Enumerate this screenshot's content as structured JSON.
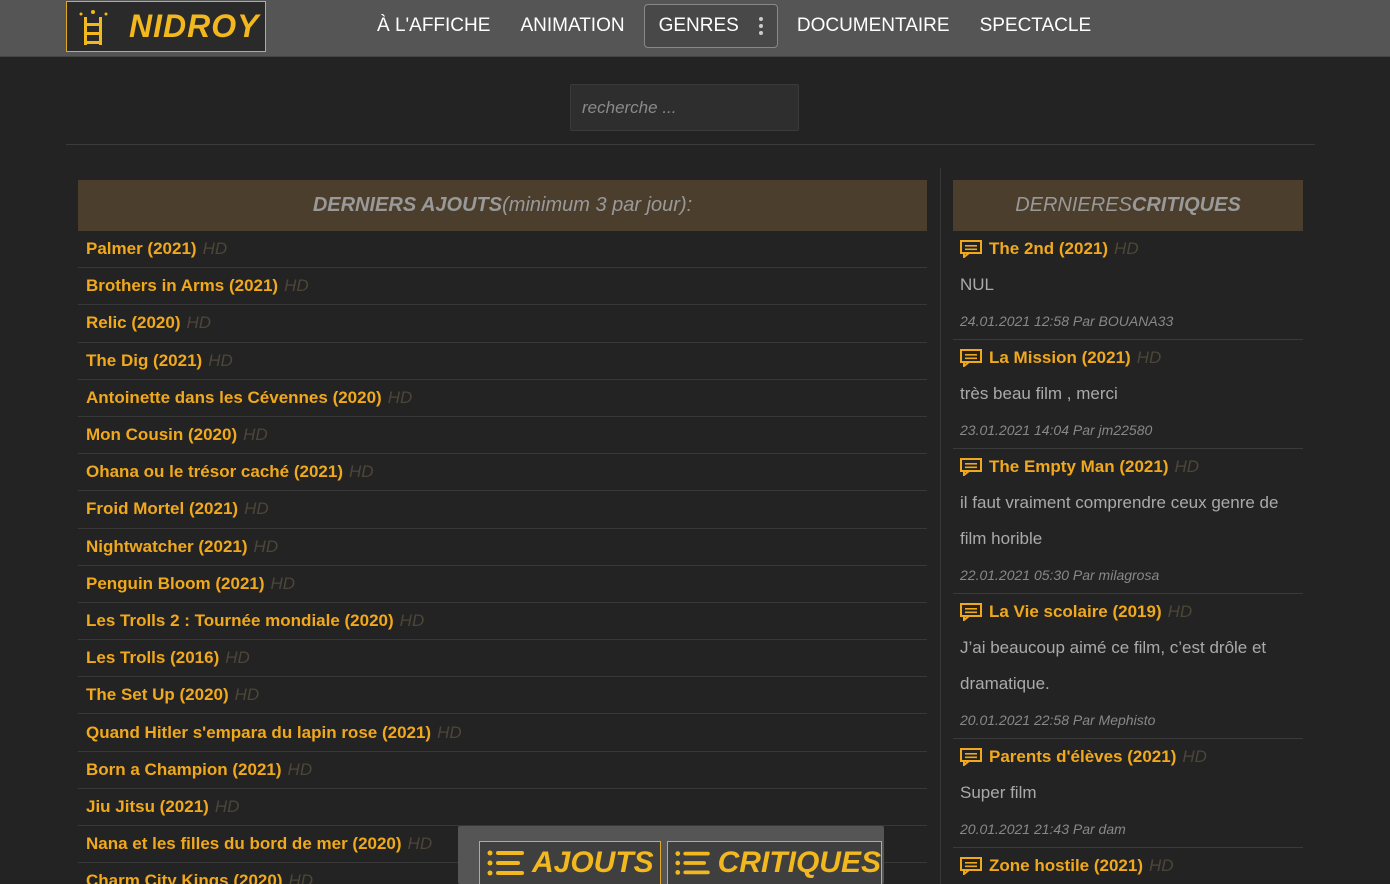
{
  "header": {
    "logo_text": "NIDROY",
    "nav": [
      "À L'AFFICHE",
      "ANIMATION",
      "GENRES",
      "DOCUMENTAIRE",
      "SPECTACLE"
    ],
    "active_index": 2
  },
  "search": {
    "placeholder": "recherche ..."
  },
  "latest": {
    "title_main": "DERNIERS AJOUTS",
    "title_sub": " (minimum 3 par jour):",
    "hd_label": "HD",
    "items": [
      "Palmer (2021)",
      "Brothers in Arms (2021)",
      "Relic (2020)",
      "The Dig (2021)",
      "Antoinette dans les Cévennes (2020)",
      "Mon Cousin (2020)",
      "Ohana ou le trésor caché (2021)",
      "Froid Mortel (2021)",
      "Nightwatcher (2021)",
      "Penguin Bloom (2021)",
      "Les Trolls 2 : Tournée mondiale (2020)",
      "Les Trolls (2016)",
      "The Set Up (2020)",
      "Quand Hitler s'empara du lapin rose (2021)",
      "Born a Champion (2021)",
      "Jiu Jitsu (2021)",
      "Nana et les filles du bord de mer (2020)",
      "Charm City Kings (2020)"
    ]
  },
  "reviews": {
    "title_light": "DERNIERES ",
    "title_bold": "CRITIQUES",
    "hd_label": "HD",
    "items": [
      {
        "title": "The 2nd (2021)",
        "text": "NUL",
        "meta": "24.01.2021 12:58 Par BOUANA33"
      },
      {
        "title": "La Mission (2021)",
        "text": "très beau film , merci",
        "meta": "23.01.2021 14:04 Par jm22580"
      },
      {
        "title": "The Empty Man (2021)",
        "text": "il faut vraiment comprendre ceux genre de film horible",
        "meta": "22.01.2021 05:30 Par milagrosa"
      },
      {
        "title": "La Vie scolaire (2019)",
        "text": "J’ai beaucoup aimé ce film, c’est drôle et dramatique.",
        "meta": "20.01.2021 22:58 Par Mephisto"
      },
      {
        "title": "Parents d'élèves (2021)",
        "text": "Super film",
        "meta": "20.01.2021 21:43 Par dam"
      },
      {
        "title": "Zone hostile (2021)",
        "text": "",
        "meta": ""
      }
    ]
  },
  "bottom_bar": {
    "ajouts": "AJOUTS",
    "critiques": "CRITIQUES"
  },
  "colors": {
    "accent": "#f0a81d",
    "header_bg": "#555555",
    "panel_head": "#4b3e2d",
    "page_bg": "#232323"
  }
}
